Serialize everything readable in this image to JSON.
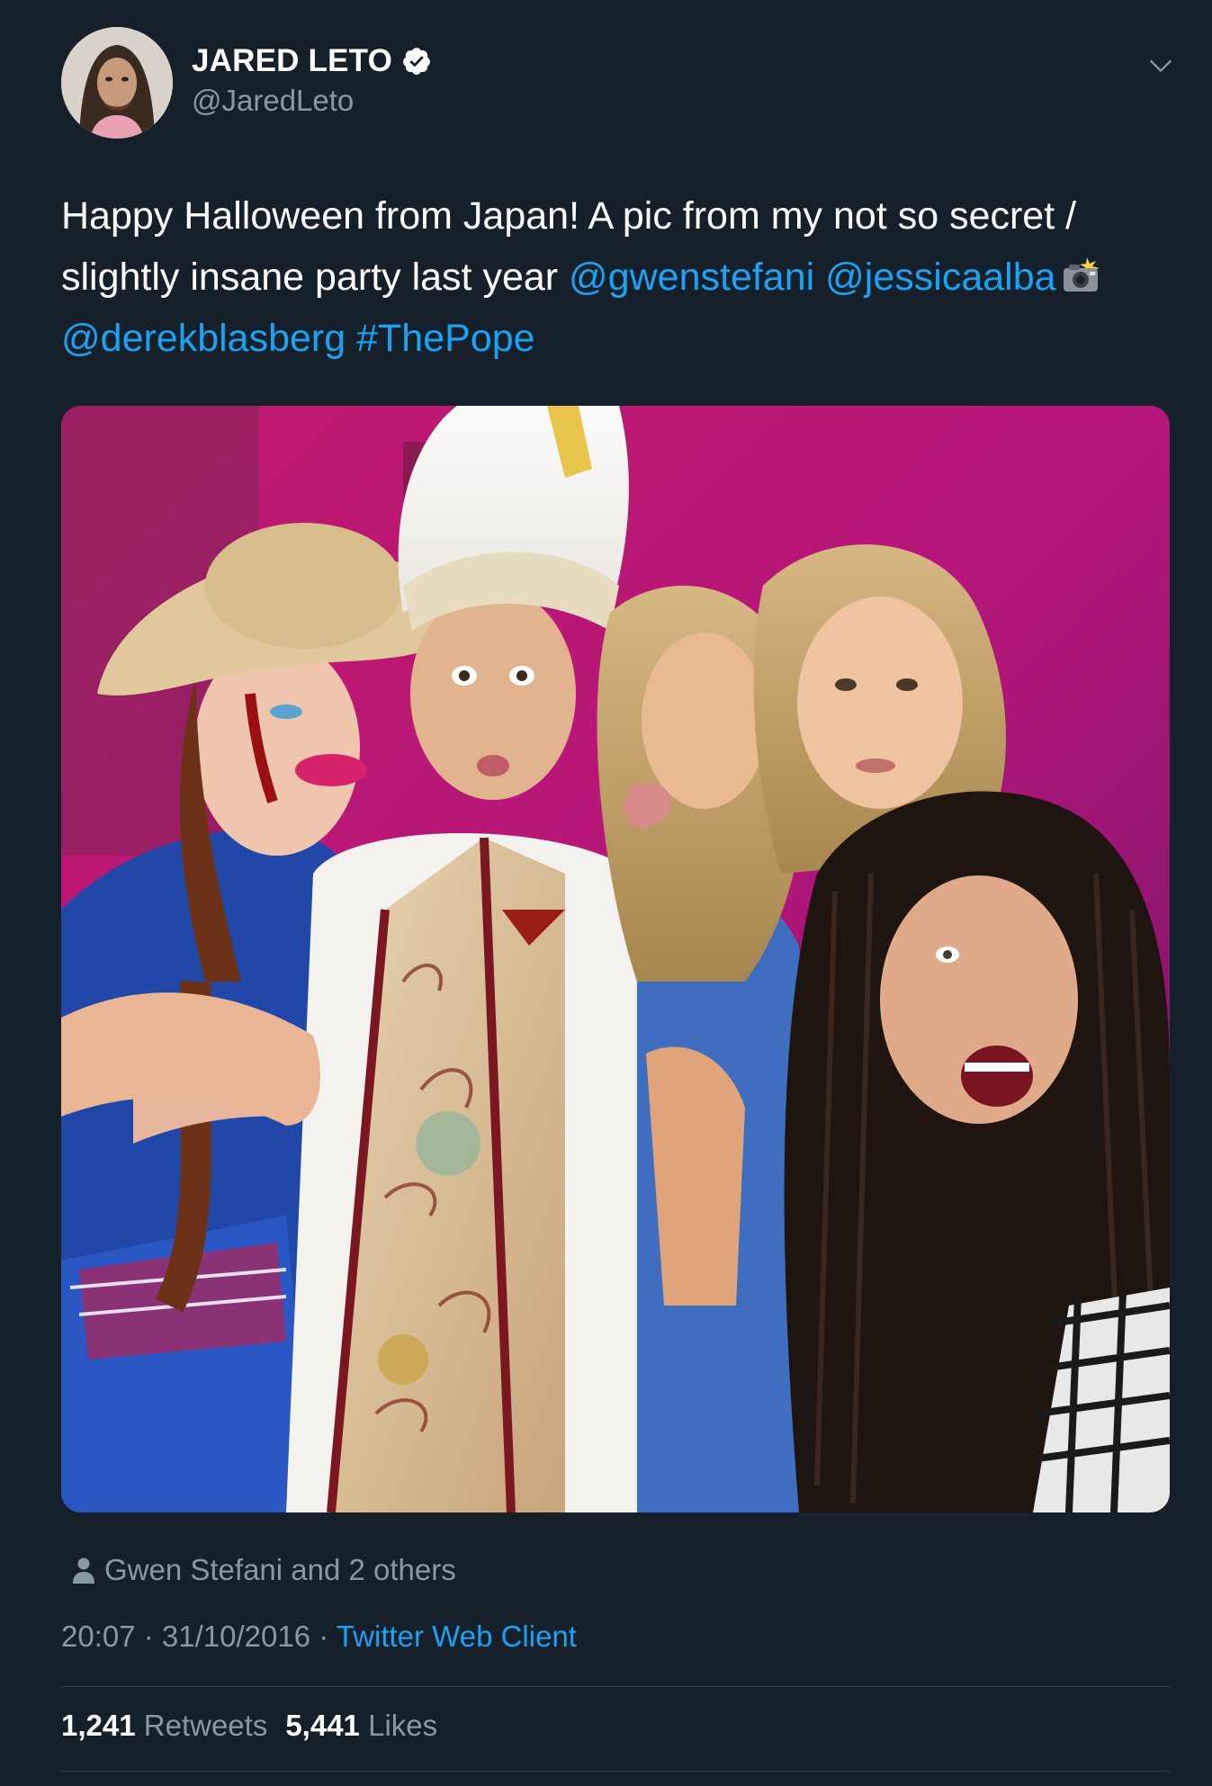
{
  "author": {
    "display_name": "JARED LETO",
    "handle": "@JaredLeto",
    "verified": true
  },
  "icons": {
    "verified": "verified-badge-icon",
    "caret": "chevron-down-icon",
    "tagged": "person-icon",
    "emoji": "camera-with-flash-emoji"
  },
  "tweet": {
    "text_part1": "Happy Halloween from Japan! A pic from my not so secret / slightly insane party last year ",
    "mention1": "@gwenstefani",
    "space1": " ",
    "mention2": "@jessicaalba",
    "space2": " ",
    "mention3": "@derekblasberg",
    "space3": " ",
    "hashtag": "#ThePope"
  },
  "tagged": {
    "label": "Gwen Stefani and 2 others"
  },
  "meta": {
    "time": "20:07",
    "sep1": " · ",
    "date": "31/10/2016",
    "sep2": " · ",
    "source": "Twitter Web Client"
  },
  "stats": {
    "retweets_count": "1,241",
    "retweets_label": "Retweets",
    "likes_count": "5,441",
    "likes_label": "Likes"
  },
  "colors": {
    "background": "#15202b",
    "link": "#1da1f2",
    "secondary_text": "#8899a6",
    "divider": "#38444d"
  }
}
